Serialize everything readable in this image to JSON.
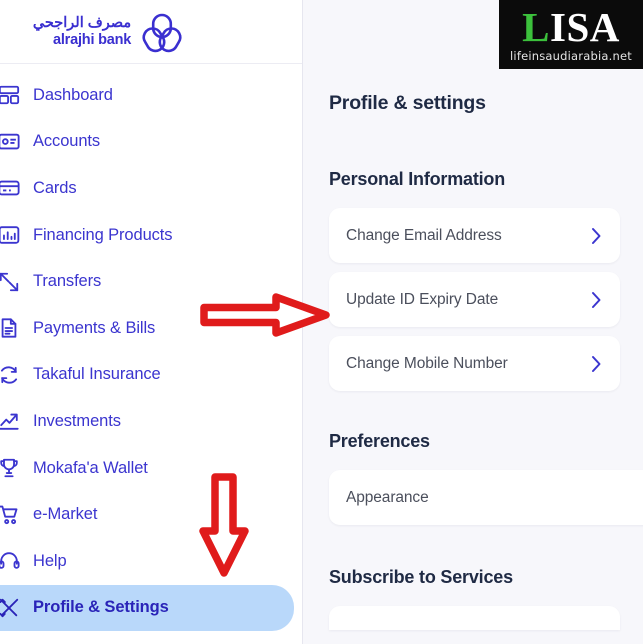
{
  "brand": {
    "name_ar": "مصرف الراجحي",
    "name_en": "alrajhi bank",
    "logo_icon": "alrajhi-trefoil-logo",
    "color": "#3a2fd0"
  },
  "sidebar": {
    "accent_color": "#3b35cf",
    "active_background": "#b9d8fa",
    "items": [
      {
        "label": "Dashboard",
        "icon": "dashboard-icon",
        "active": false
      },
      {
        "label": "Accounts",
        "icon": "accounts-icon",
        "active": false
      },
      {
        "label": "Cards",
        "icon": "card-icon",
        "active": false
      },
      {
        "label": "Financing Products",
        "icon": "bar-chart-icon",
        "active": false
      },
      {
        "label": "Transfers",
        "icon": "transfers-icon",
        "active": false
      },
      {
        "label": "Payments & Bills",
        "icon": "invoice-icon",
        "active": false
      },
      {
        "label": "Takaful Insurance",
        "icon": "shield-cycle-icon",
        "active": false
      },
      {
        "label": "Investments",
        "icon": "trending-up-icon",
        "active": false
      },
      {
        "label": "Mokafa'a Wallet",
        "icon": "trophy-icon",
        "active": false
      },
      {
        "label": "e-Market",
        "icon": "shopping-cart-icon",
        "active": false
      },
      {
        "label": "Help",
        "icon": "headset-icon",
        "active": false
      },
      {
        "label": "Profile & Settings",
        "icon": "tools-icon",
        "active": true
      }
    ]
  },
  "main": {
    "page_title": "Profile & settings",
    "background": "#f7f7fb",
    "chevron_icon": "chevron-right-icon",
    "chevron_color": "#3b35cf",
    "sections": [
      {
        "title": "Personal Information",
        "items": [
          {
            "label": "Change Email Address"
          },
          {
            "label": "Update ID Expiry Date"
          },
          {
            "label": "Change Mobile Number"
          }
        ]
      },
      {
        "title": "Preferences",
        "items": [
          {
            "label": "Appearance"
          }
        ]
      },
      {
        "title": "Subscribe to Services",
        "items": []
      }
    ]
  },
  "watermark": {
    "main_first": "L",
    "main_rest": "ISA",
    "subtitle": "lifeinsaudiarabia.net",
    "accent_color": "#3cc13c",
    "background": "#0b0b0b"
  },
  "annotations": {
    "color": "#e01b1b",
    "arrow_right": {
      "target": "Update ID Expiry Date",
      "direction": "right"
    },
    "arrow_down": {
      "target": "Profile & Settings",
      "direction": "down"
    }
  }
}
